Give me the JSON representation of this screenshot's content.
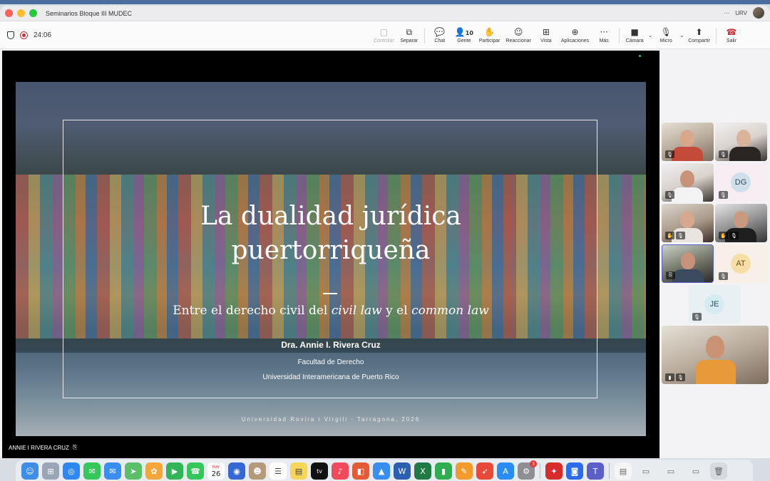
{
  "window": {
    "title": "Seminarios Bloque III MUDEC",
    "org_label": "URV",
    "more_label": "···"
  },
  "call": {
    "timer": "24:06"
  },
  "toolbar": {
    "controlar": "Controlar",
    "separar": "Separar",
    "chat": "Chat",
    "people_count": "10",
    "gente": "Gente",
    "participar": "Participar",
    "reaccionar": "Reaccionar",
    "vista": "Vista",
    "aplicaciones": "Aplicaciones",
    "mas": "Más",
    "camara": "Cámara",
    "micro": "Micro",
    "compartir": "Compartir",
    "salir": "Salir"
  },
  "slide": {
    "title_line1": "La dualidad jurídica",
    "title_line2": "puertorriqueña",
    "subtitle_prefix": "Entre el derecho civil del ",
    "subtitle_em1": "civil law",
    "subtitle_mid": " y el ",
    "subtitle_em2": "common law",
    "author": "Dra. Annie I. Rivera Cruz",
    "faculty": "Facultad de Derecho",
    "university": "Universidad Interamericana de Puerto Rico",
    "footer": "Universidad Rovira i Virgili · Tarragona, 2026"
  },
  "speaker": {
    "name": "ANNIE I RIVERA CRUZ"
  },
  "participants": [
    {
      "type": "video",
      "muted": true
    },
    {
      "type": "video",
      "muted": true
    },
    {
      "type": "video",
      "muted": true
    },
    {
      "type": "initials",
      "initials": "DG",
      "muted": true
    },
    {
      "type": "video",
      "muted": true
    },
    {
      "type": "video",
      "muted": true
    },
    {
      "type": "video",
      "muted": true,
      "active": true
    },
    {
      "type": "initials",
      "initials": "AT",
      "muted": true
    },
    {
      "type": "initials",
      "initials": "JE",
      "muted": true
    },
    {
      "type": "video",
      "muted": true,
      "self": true
    }
  ],
  "dock": {
    "calendar_day": "26",
    "calendar_month": "MAY",
    "settings_badge": "3"
  }
}
